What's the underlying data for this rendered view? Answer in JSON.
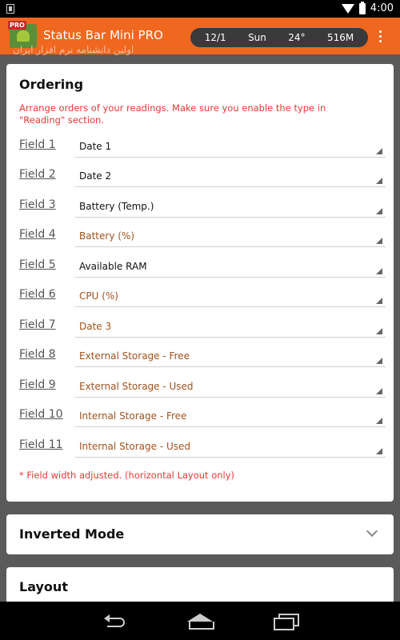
{
  "system_bar": {
    "time": "4:00"
  },
  "app_bar": {
    "pro_badge": "PRO",
    "title": "Status Bar Mini PRO",
    "watermark": "اولین دانشنامه نرم افزار ایران",
    "readings": [
      "12/1",
      "Sun",
      "24°",
      "516M"
    ]
  },
  "ordering": {
    "title": "Ordering",
    "hint": "Arrange orders of your readings. Make sure you enable the type in \"Reading\" section.",
    "fields": [
      {
        "label": "Field 1",
        "value": "Date 1"
      },
      {
        "label": "Field 2",
        "value": "Date 2"
      },
      {
        "label": "Field 3",
        "value": "Battery (Temp.)"
      },
      {
        "label": "Field 4",
        "value": "Battery (%)"
      },
      {
        "label": "Field 5",
        "value": "Available RAM"
      },
      {
        "label": "Field 6",
        "value": "CPU (%)"
      },
      {
        "label": "Field 7",
        "value": "Date 3"
      },
      {
        "label": "Field 8",
        "value": "External Storage - Free"
      },
      {
        "label": "Field 9",
        "value": "External Storage - Used"
      },
      {
        "label": "Field 10",
        "value": "Internal Storage - Free"
      },
      {
        "label": "Field 11",
        "value": "Internal Storage - Used"
      }
    ],
    "note": "* Field width adjusted. (horizontal Layout only)"
  },
  "inverted_mode": {
    "title": "Inverted Mode"
  },
  "layout": {
    "title": "Layout"
  },
  "colors": {
    "app_bar": "#f0671f",
    "hint_red": "#e53935",
    "accent_value": "#a0521e"
  }
}
